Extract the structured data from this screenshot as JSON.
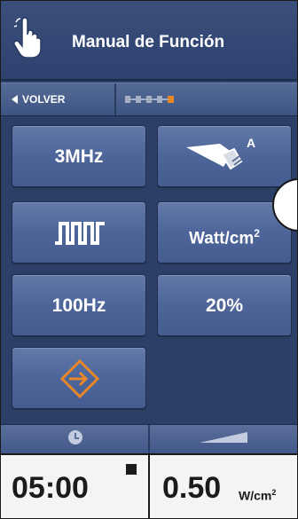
{
  "header": {
    "title": "Manual de Función",
    "icon": "hand-pointer-icon"
  },
  "nav": {
    "back_label": "VOLVER",
    "back_icon": "back-arrow-icon",
    "progress_icon": "step-progress-icon",
    "progress_accent": "#e8862a"
  },
  "controls": {
    "frequency": "3MHz",
    "head_icon": "transducer-head-icon",
    "head_label": "A",
    "mode_icon": "pulsed-wave-icon",
    "intensity_unit": "Watt/cm",
    "intensity_unit_exp": "2",
    "pulse_rate": "100Hz",
    "duty_cycle": "20%",
    "enter_icon": "enter-arrow-icon",
    "enter_color": "#e8862a"
  },
  "status": {
    "time_icon": "clock-icon",
    "power_icon": "ramp-icon",
    "time_value": "05:00",
    "stop_icon": "stop-square-icon",
    "power_value": "0.50",
    "power_unit": "W/cm",
    "power_unit_exp": "2"
  },
  "colors": {
    "panel": "#2c3f66",
    "button": "#4e659a",
    "accent": "#e8862a"
  }
}
